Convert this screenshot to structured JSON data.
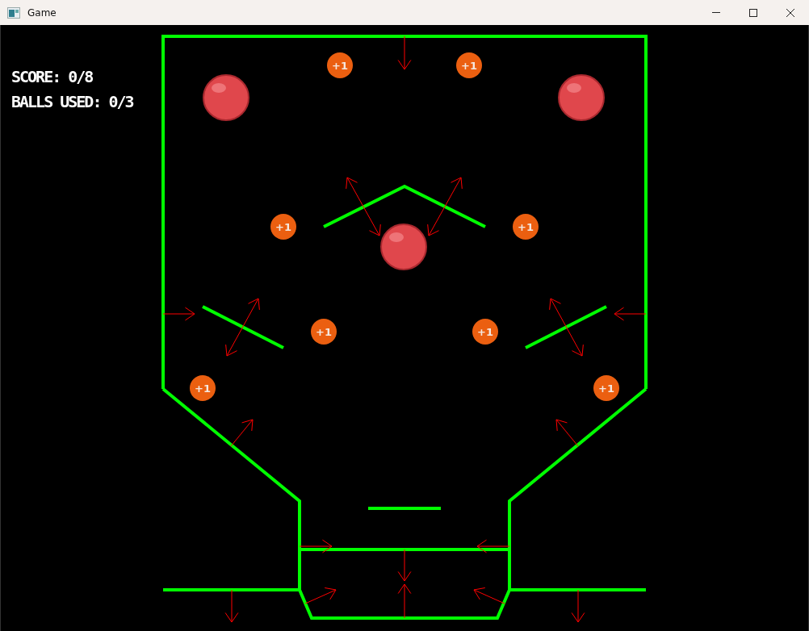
{
  "window": {
    "title": "Game"
  },
  "hud": {
    "score": "SCORE: 0/8",
    "balls_used": "BALLS USED: 0/3"
  },
  "tokens": [
    {
      "label": "+1"
    },
    {
      "label": "+1"
    },
    {
      "label": "+1"
    },
    {
      "label": "+1"
    },
    {
      "label": "+1"
    },
    {
      "label": "+1"
    },
    {
      "label": "+1"
    },
    {
      "label": "+1"
    }
  ]
}
